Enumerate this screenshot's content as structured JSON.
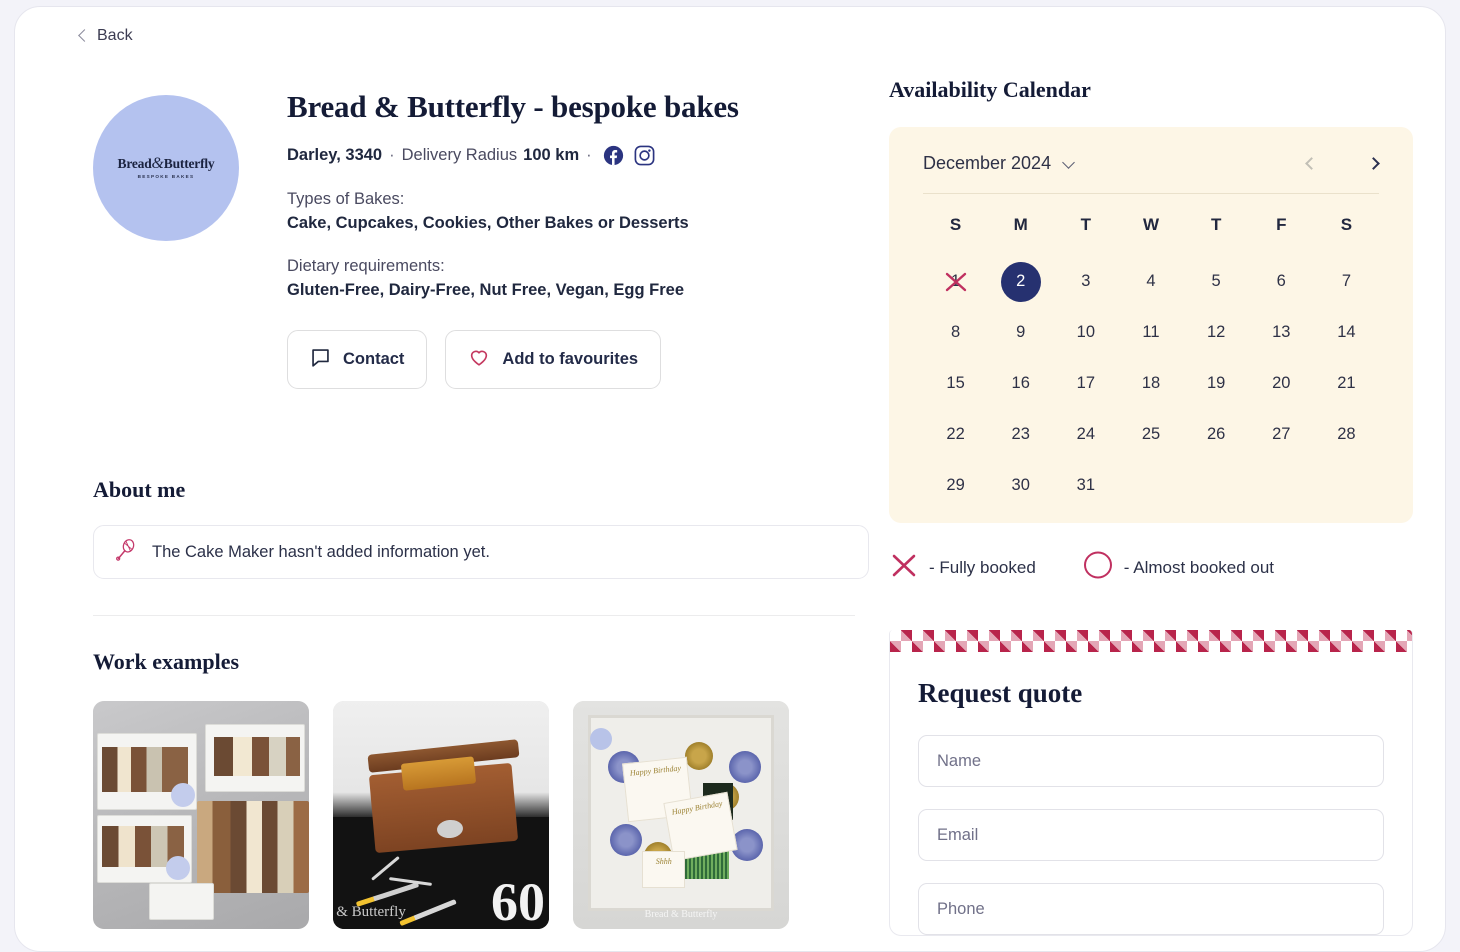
{
  "nav": {
    "back_label": "Back"
  },
  "profile": {
    "avatar_logo_line1_a": "Bread",
    "avatar_logo_line1_amp": "&",
    "avatar_logo_line1_b": "Butterfly",
    "avatar_logo_line2": "BESPOKE BAKES",
    "title": "Bread & Butterfly - bespoke bakes",
    "location": "Darley, 3340",
    "delivery_label": "Delivery Radius",
    "delivery_value": "100 km",
    "separator": "·",
    "social": [
      {
        "name": "facebook-icon"
      },
      {
        "name": "instagram-icon"
      }
    ],
    "types_label": "Types of Bakes:",
    "types_value": "Cake, Cupcakes, Cookies, Other Bakes or Desserts",
    "dietary_label": "Dietary requirements:",
    "dietary_value": "Gluten-Free, Dairy-Free, Nut Free, Vegan, Egg Free",
    "contact_button": "Contact",
    "favourites_button": "Add to favourites"
  },
  "about": {
    "heading": "About me",
    "empty_text": "The Cake Maker hasn't added information yet.",
    "icon": "whisk-icon"
  },
  "work": {
    "heading": "Work examples",
    "items": [
      {
        "caption": ""
      },
      {
        "caption": "60",
        "watermark": "d & Butterfly"
      },
      {
        "caption": "",
        "watermark": "Bread & Butterfly",
        "card1": "Happy Birthday",
        "card2": "Happy Birthday",
        "card3": "Shhh"
      }
    ]
  },
  "calendar": {
    "heading": "Availability Calendar",
    "month": "December 2024",
    "prev_label": "‹",
    "next_label": "›",
    "dow": [
      "S",
      "M",
      "T",
      "W",
      "T",
      "F",
      "S"
    ],
    "lead_blanks": 0,
    "days": [
      {
        "n": "1",
        "state": "booked"
      },
      {
        "n": "2",
        "state": "selected"
      },
      {
        "n": "3",
        "state": "normal"
      },
      {
        "n": "4",
        "state": "normal"
      },
      {
        "n": "5",
        "state": "normal"
      },
      {
        "n": "6",
        "state": "normal"
      },
      {
        "n": "7",
        "state": "normal"
      },
      {
        "n": "8",
        "state": "normal"
      },
      {
        "n": "9",
        "state": "normal"
      },
      {
        "n": "10",
        "state": "normal"
      },
      {
        "n": "11",
        "state": "normal"
      },
      {
        "n": "12",
        "state": "normal"
      },
      {
        "n": "13",
        "state": "normal"
      },
      {
        "n": "14",
        "state": "normal"
      },
      {
        "n": "15",
        "state": "normal"
      },
      {
        "n": "16",
        "state": "normal"
      },
      {
        "n": "17",
        "state": "normal"
      },
      {
        "n": "18",
        "state": "normal"
      },
      {
        "n": "19",
        "state": "normal"
      },
      {
        "n": "20",
        "state": "normal"
      },
      {
        "n": "21",
        "state": "normal"
      },
      {
        "n": "22",
        "state": "normal"
      },
      {
        "n": "23",
        "state": "normal"
      },
      {
        "n": "24",
        "state": "normal"
      },
      {
        "n": "25",
        "state": "normal"
      },
      {
        "n": "26",
        "state": "normal"
      },
      {
        "n": "27",
        "state": "normal"
      },
      {
        "n": "28",
        "state": "normal"
      },
      {
        "n": "29",
        "state": "normal"
      },
      {
        "n": "30",
        "state": "normal"
      },
      {
        "n": "31",
        "state": "normal"
      }
    ],
    "legend": [
      {
        "icon": "x-mark-icon",
        "text": "- Fully booked"
      },
      {
        "icon": "circle-icon",
        "text": "- Almost booked out"
      }
    ]
  },
  "quote": {
    "title": "Request quote",
    "fields": [
      {
        "name": "name",
        "placeholder": "Name",
        "value": ""
      },
      {
        "name": "email",
        "placeholder": "Email",
        "value": ""
      },
      {
        "name": "phone",
        "placeholder": "Phone",
        "value": ""
      }
    ]
  },
  "colors": {
    "navy": "#141b36",
    "accent_blue": "#263170",
    "avatar_blue": "#b4c2ef",
    "calendar_bg": "#fdf6e6",
    "crimson": "#b8244b",
    "gingham_light": "#e4a6b6"
  }
}
